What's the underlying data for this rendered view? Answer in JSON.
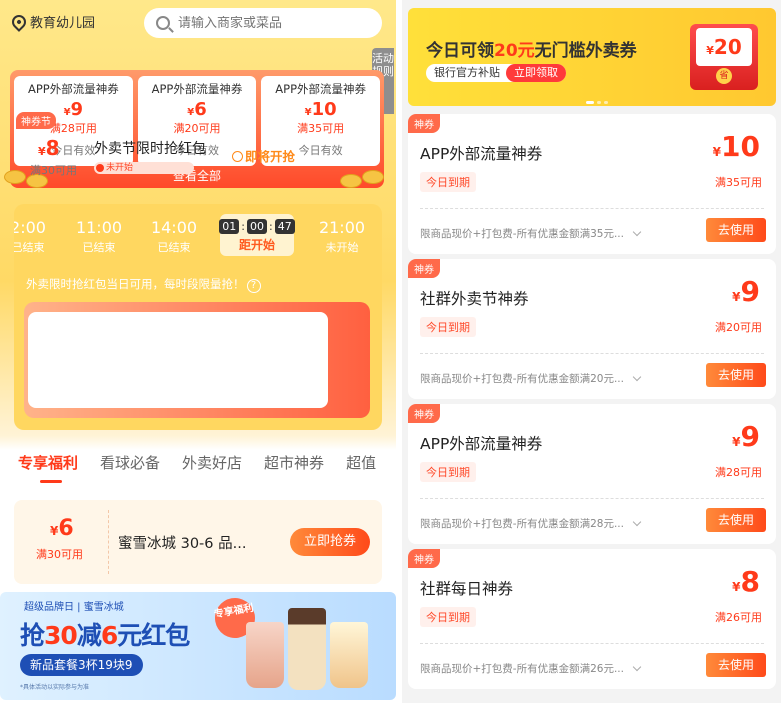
{
  "location": "教育幼儿园",
  "search": {
    "placeholder": "请输入商家或菜品"
  },
  "rules_label": "活动规则",
  "top_coupons": [
    {
      "title": "APP外部流量神券",
      "currency": "¥",
      "amount": "9",
      "condition": "满28可用",
      "validity": "今日有效"
    },
    {
      "title": "APP外部流量神券",
      "currency": "¥",
      "amount": "6",
      "condition": "满20可用",
      "validity": "今日有效"
    },
    {
      "title": "APP外部流量神券",
      "currency": "¥",
      "amount": "10",
      "condition": "满35可用",
      "validity": "今日有效"
    }
  ],
  "view_all": "查看全部",
  "flash": {
    "slots": [
      {
        "time": "2:00",
        "status": "已结束"
      },
      {
        "time": "11:00",
        "status": "已结束"
      },
      {
        "time": "14:00",
        "status": "已结束"
      },
      {
        "countdown": [
          "01",
          "00",
          "47"
        ],
        "status": "距开始"
      },
      {
        "time": "21:00",
        "status": "未开始"
      }
    ],
    "note": "外卖限时抢红包当日可用，每时段限量抢！",
    "note_icon": "?",
    "card": {
      "tag": "神券节",
      "currency": "¥",
      "amount": "8",
      "condition": "满30可用",
      "title": "外卖节限时抢红包",
      "status": "未开始",
      "button": "即将开抢"
    }
  },
  "tabs": [
    "专享福利",
    "看球必备",
    "外卖好店",
    "超市神券",
    "超值"
  ],
  "deal": {
    "currency": "¥",
    "amount": "6",
    "condition": "满30可用",
    "title": "蜜雪冰城 30-6 品...",
    "button": "立即抢券"
  },
  "banner": {
    "brand": "超级品牌日 | 蜜雪冰城",
    "headline_pre": "抢",
    "headline_num1": "30",
    "headline_mid": "减",
    "headline_num2": "6",
    "headline_post": "元红包",
    "sub": "新品套餐3杯19块9",
    "badge": "专享福利",
    "fine": "*具体活动以实际参与为准"
  },
  "right_banner": {
    "title_pre": "今日可领",
    "title_hl": "20元",
    "title_post": "无门槛外卖券",
    "sub": "银行官方补贴",
    "button": "立即领取",
    "env_currency": "¥",
    "env_amount": "20",
    "env_coin": "省"
  },
  "right_coupons": [
    {
      "tag": "神券",
      "title": "APP外部流量神券",
      "expiry": "今日到期",
      "currency": "¥",
      "amount": "10",
      "condition": "满35可用",
      "desc": "限商品现价+打包费-所有优惠金额满35元...",
      "button": "去使用"
    },
    {
      "tag": "神券",
      "title": "社群外卖节神券",
      "expiry": "今日到期",
      "currency": "¥",
      "amount": "9",
      "condition": "满20可用",
      "desc": "限商品现价+打包费-所有优惠金额满20元...",
      "button": "去使用"
    },
    {
      "tag": "神券",
      "title": "APP外部流量神券",
      "expiry": "今日到期",
      "currency": "¥",
      "amount": "9",
      "condition": "满28可用",
      "desc": "限商品现价+打包费-所有优惠金额满28元...",
      "button": "去使用"
    },
    {
      "tag": "神券",
      "title": "社群每日神券",
      "expiry": "今日到期",
      "currency": "¥",
      "amount": "8",
      "condition": "满26可用",
      "desc": "限商品现价+打包费-所有优惠金额满26元...",
      "button": "去使用"
    }
  ],
  "colors": {
    "accent": "#ff3a1a",
    "yellow": "#ffd760",
    "orange_btn": "#ff6a2a"
  }
}
